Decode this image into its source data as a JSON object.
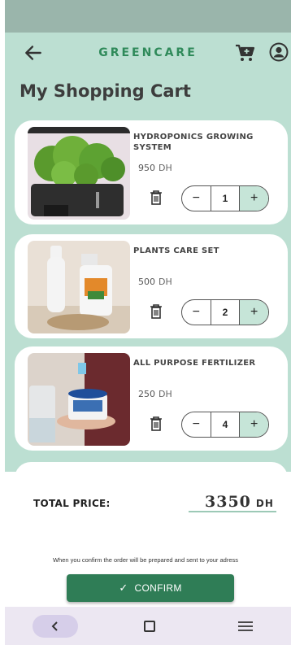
{
  "header": {
    "brand": "GREENCARE",
    "back_icon": "arrow-left-icon",
    "cart_icon": "cart-icon",
    "account_icon": "user-circle-icon"
  },
  "page_title": "My Shopping Cart",
  "cart": {
    "items": [
      {
        "name": "HYDROPONICS GROWING SYSTEM",
        "price": "950",
        "currency": "DH",
        "quantity": "1",
        "minus": "−",
        "plus": "+"
      },
      {
        "name": "PLANTS CARE SET",
        "price": "500",
        "currency": "DH",
        "quantity": "2",
        "minus": "−",
        "plus": "+"
      },
      {
        "name": "ALL PURPOSE FERTILIZER",
        "price": "250",
        "currency": "DH",
        "quantity": "4",
        "minus": "−",
        "plus": "+"
      }
    ]
  },
  "summary": {
    "total_label": "TOTAL PRICE:",
    "total_value": "3350",
    "total_currency": "DH",
    "note": "When you confirm the order will be prepared and sent to your adress",
    "confirm_label": "CONFIRM"
  },
  "colors": {
    "brand_green": "#2f8a5a",
    "app_background": "#bcdfd2",
    "confirm_button": "#2f7d56"
  }
}
